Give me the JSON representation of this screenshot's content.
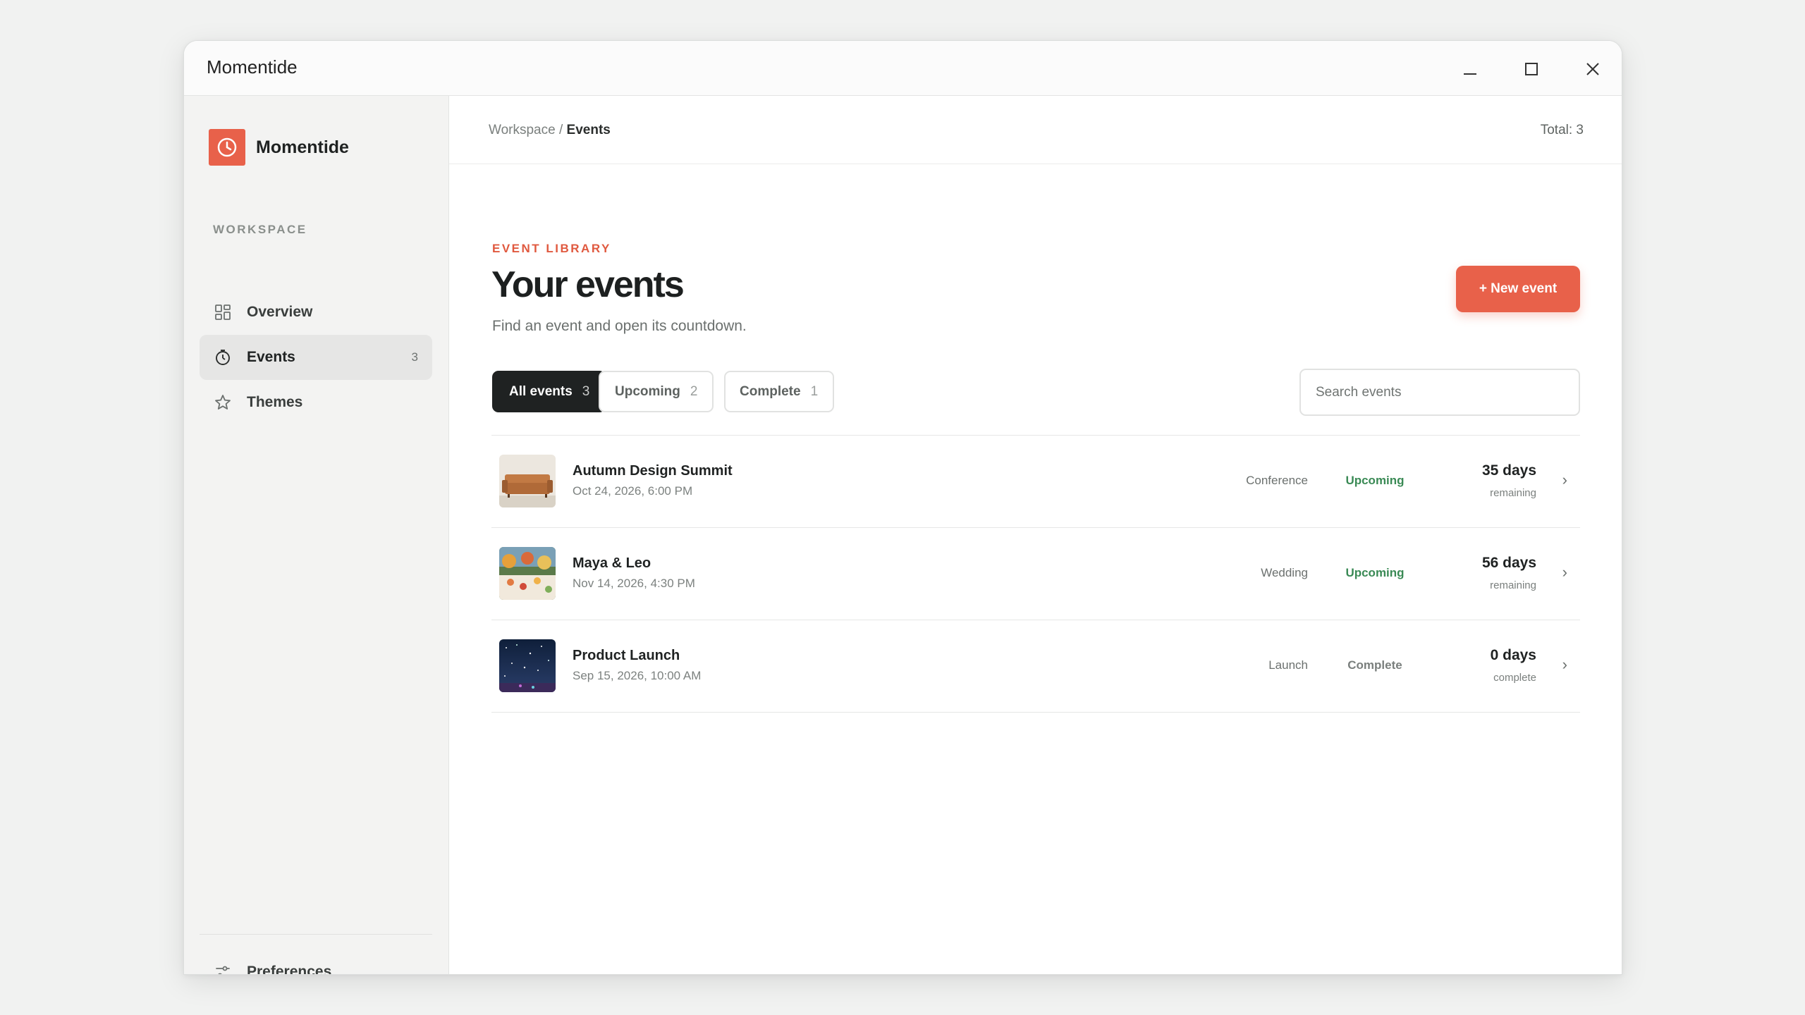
{
  "window": {
    "title": "Momentide"
  },
  "sidebar": {
    "brand": "Momentide",
    "section_label": "WORKSPACE",
    "items": [
      {
        "label": "Overview",
        "icon": "grid-icon"
      },
      {
        "label": "Events",
        "icon": "clock-icon",
        "count": "3",
        "active": true
      },
      {
        "label": "Themes",
        "icon": "star-icon"
      }
    ],
    "footer": {
      "label": "Preferences",
      "icon": "sliders-icon"
    }
  },
  "header": {
    "breadcrumb_root": "Workspace",
    "breadcrumb_sep": " / ",
    "breadcrumb_current": "Events",
    "total": "Total: 3"
  },
  "page": {
    "eyebrow": "EVENT LIBRARY",
    "title": "Your events",
    "subtitle": "Find an event and open its countdown.",
    "new_button": "+ New event"
  },
  "tabs": [
    {
      "label": "All events",
      "count": "3",
      "active": true
    },
    {
      "label": "Upcoming",
      "count": "2"
    },
    {
      "label": "Complete",
      "count": "1"
    }
  ],
  "search": {
    "placeholder": "Search events",
    "value": ""
  },
  "events": [
    {
      "name": "Autumn Design Summit",
      "date": "Oct 24, 2026, 6:00 PM",
      "category": "Conference",
      "status": "Upcoming",
      "days": "35 days",
      "days_sub": "remaining",
      "thumb": "sofa-photo"
    },
    {
      "name": "Maya & Leo",
      "date": "Nov 14, 2026, 4:30 PM",
      "category": "Wedding",
      "status": "Upcoming",
      "days": "56 days",
      "days_sub": "remaining",
      "thumb": "dinner-table-photo"
    },
    {
      "name": "Product Launch",
      "date": "Sep 15, 2026, 10:00 AM",
      "category": "Launch",
      "status": "Complete",
      "days": "0 days",
      "days_sub": "complete",
      "thumb": "night-sky-photo"
    }
  ],
  "colors": {
    "accent": "#e8614a",
    "upcoming": "#3a8a55",
    "dark": "#1f2222"
  }
}
